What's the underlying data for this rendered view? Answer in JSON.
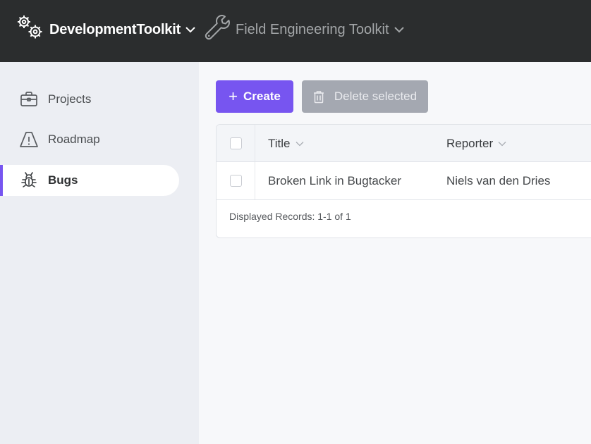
{
  "topbar": {
    "active_app": "DevelopmentToolkit",
    "other_app": "Field Engineering Toolkit"
  },
  "sidebar": {
    "items": [
      {
        "label": "Projects",
        "icon": "briefcase-icon",
        "active": false
      },
      {
        "label": "Roadmap",
        "icon": "warning-triangle-icon",
        "active": false
      },
      {
        "label": "Bugs",
        "icon": "bug-icon",
        "active": true
      }
    ]
  },
  "toolbar": {
    "create_label": "Create",
    "delete_label": "Delete selected"
  },
  "table": {
    "columns": [
      "Title",
      "Reporter"
    ],
    "rows": [
      {
        "title": "Broken Link in Bugtacker",
        "reporter": "Niels van den Dries"
      }
    ],
    "footer": "Displayed Records: 1-1 of 1"
  },
  "colors": {
    "accent": "#7755f0",
    "topbar": "#2b2d2e",
    "sidebar": "#eceef3"
  }
}
